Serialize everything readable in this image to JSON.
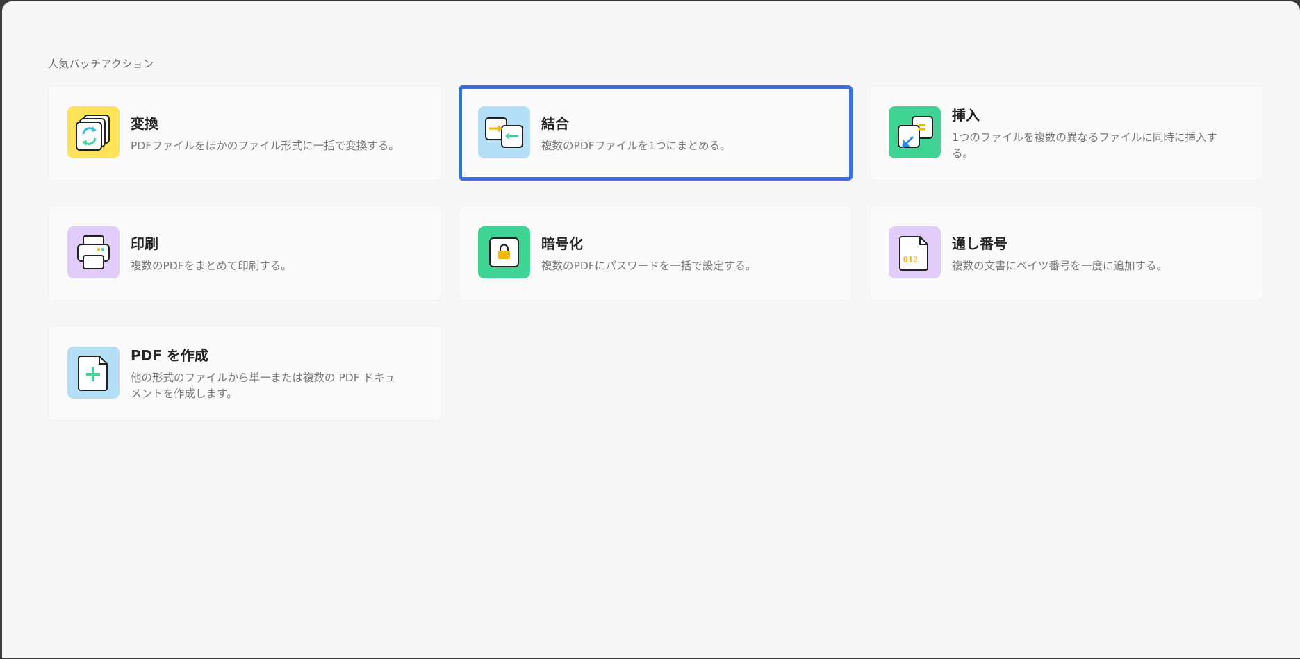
{
  "section": {
    "title": "人気バッチアクション"
  },
  "cards": [
    {
      "title": "変換",
      "desc": "PDFファイルをほかのファイル形式に一括で変換する。",
      "icon": "convert-icon",
      "tile_color": "#ffe45a"
    },
    {
      "title": "結合",
      "desc": "複数のPDFファイルを1つにまとめる。",
      "icon": "combine-icon",
      "tile_color": "#b4dff6"
    },
    {
      "title": "挿入",
      "desc": "1つのファイルを複数の異なるファイルに同時に挿入する。",
      "icon": "insert-icon",
      "tile_color": "#3fd394"
    },
    {
      "title": "印刷",
      "desc": "複数のPDFをまとめて印刷する。",
      "icon": "print-icon",
      "tile_color": "#e2cdfa"
    },
    {
      "title": "暗号化",
      "desc": "複数のPDFにパスワードを一括で設定する。",
      "icon": "lock-icon",
      "tile_color": "#3fd394"
    },
    {
      "title": "通し番号",
      "desc": "複数の文書にベイツ番号を一度に追加する。",
      "icon": "bates-number-icon",
      "tile_color": "#e2cdfa",
      "icon_text": "012"
    },
    {
      "title": "PDF を作成",
      "desc": "他の形式のファイルから単一または複数の PDF ドキュメントを作成します。",
      "icon": "create-pdf-icon",
      "tile_color": "#b4dff6"
    }
  ],
  "selected_card": "結合",
  "colors": {
    "selection_border": "#3a6fe0",
    "window_bg": "#f7f7f7",
    "card_bg": "#fafafa"
  }
}
